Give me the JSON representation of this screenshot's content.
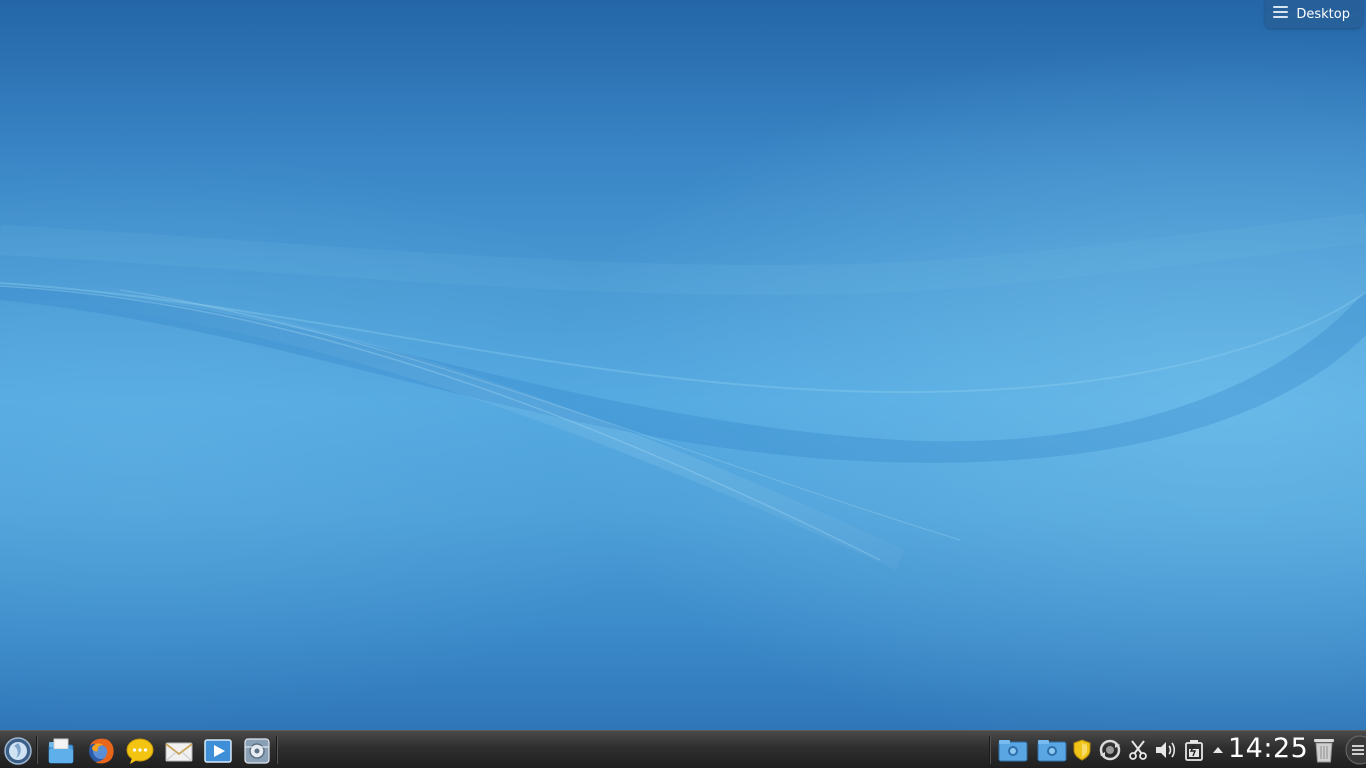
{
  "desktop": {
    "toolbox_label": "Desktop"
  },
  "taskbar": {
    "launchers": [
      {
        "icon": "application-launcher-icon"
      },
      {
        "icon": "file-manager-icon"
      },
      {
        "icon": "firefox-icon"
      },
      {
        "icon": "chat-icon"
      },
      {
        "icon": "mail-icon"
      },
      {
        "icon": "media-player-icon"
      },
      {
        "icon": "system-settings-icon"
      }
    ],
    "tray": [
      {
        "icon": "camera-folder-icon"
      },
      {
        "icon": "camera-folder-icon"
      },
      {
        "icon": "shield-icon"
      },
      {
        "icon": "update-icon"
      },
      {
        "icon": "scissors-icon"
      },
      {
        "icon": "volume-icon"
      },
      {
        "icon": "battery-icon"
      },
      {
        "icon": "expand-tray-arrow-icon"
      }
    ],
    "clock": "14:25",
    "trash_icon": "trash-icon"
  },
  "colors": {
    "wallpaper_top": "#2466a8",
    "wallpaper_mid": "#52a8e0",
    "panel": "#2f2f2f"
  }
}
